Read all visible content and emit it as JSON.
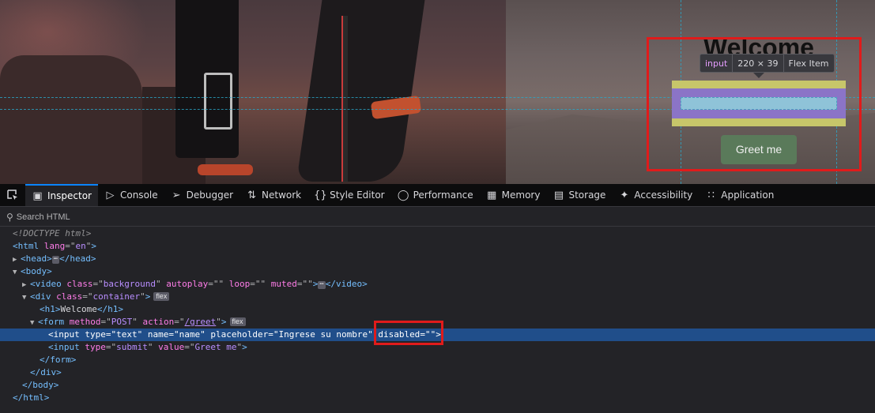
{
  "page": {
    "heading": "Welcome",
    "button_label": "Greet me"
  },
  "tooltip": {
    "tag": "input",
    "dims": "220 × 39",
    "kind": "Flex Item"
  },
  "toolbar": {
    "tabs": [
      {
        "label": "Inspector",
        "icon": "inspector-icon",
        "active": true
      },
      {
        "label": "Console",
        "icon": "console-icon"
      },
      {
        "label": "Debugger",
        "icon": "debugger-icon"
      },
      {
        "label": "Network",
        "icon": "network-icon"
      },
      {
        "label": "Style Editor",
        "icon": "style-editor-icon"
      },
      {
        "label": "Performance",
        "icon": "performance-icon"
      },
      {
        "label": "Memory",
        "icon": "memory-icon"
      },
      {
        "label": "Storage",
        "icon": "storage-icon"
      },
      {
        "label": "Accessibility",
        "icon": "accessibility-icon"
      },
      {
        "label": "Application",
        "icon": "application-icon"
      }
    ]
  },
  "search": {
    "placeholder": "Search HTML"
  },
  "tree": {
    "doctype": "<!DOCTYPE html>",
    "html_open": {
      "tag": "html",
      "attr": "lang",
      "val": "en"
    },
    "head": {
      "tag": "head"
    },
    "body": {
      "tag": "body"
    },
    "video": {
      "tag": "video",
      "class": "background",
      "autoplay": "",
      "loop": "",
      "muted": ""
    },
    "div": {
      "tag": "div",
      "class": "container",
      "badge": "flex"
    },
    "h1": {
      "tag": "h1",
      "text": "Welcome"
    },
    "form": {
      "tag": "form",
      "method": "POST",
      "action": "/greet",
      "badge": "flex"
    },
    "input_text": {
      "tag": "input",
      "type": "text",
      "name": "name",
      "placeholder": "Ingrese su nombre",
      "disabled": ""
    },
    "input_submit": {
      "tag": "input",
      "type": "submit",
      "value": "Greet me"
    },
    "form_close": "form",
    "div_close": "div",
    "body_close": "body",
    "html_close": "html"
  },
  "colors": {
    "annotation_red": "#e01b1b",
    "selected_row": "#204e8a",
    "active_tab_accent": "#0a84ff",
    "button_green": "#5a7a5a"
  }
}
